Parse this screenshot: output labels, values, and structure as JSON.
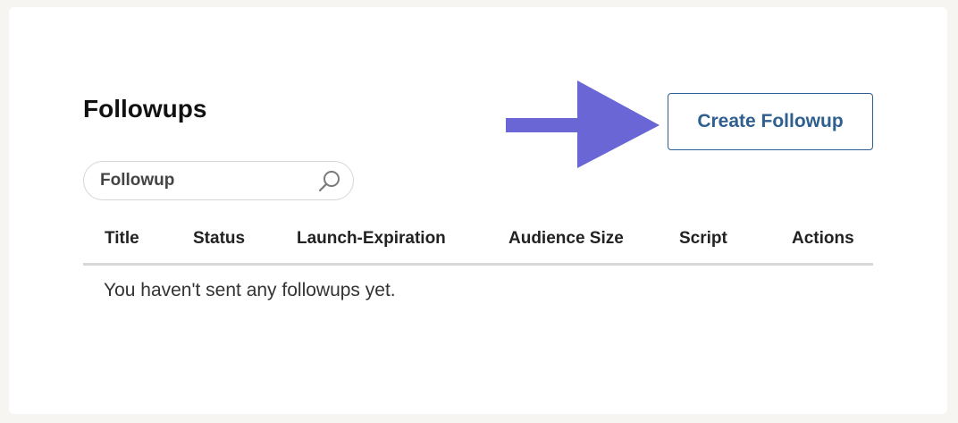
{
  "page": {
    "title": "Followups"
  },
  "toolbar": {
    "create_label": "Create Followup"
  },
  "search": {
    "placeholder": "Followup",
    "value": ""
  },
  "table": {
    "columns": [
      "Title",
      "Status",
      "Launch-Expiration",
      "Audience Size",
      "Script",
      "Actions"
    ],
    "rows": [],
    "empty_message": "You haven't sent any followups yet."
  },
  "colors": {
    "accent": "#2f5f8f",
    "arrow": "#6a66d6",
    "background": "#f6f5f1",
    "card": "#ffffff",
    "divider": "#d8d8d8"
  },
  "icons": {
    "search": "search-icon",
    "arrow": "arrow-right-icon"
  }
}
